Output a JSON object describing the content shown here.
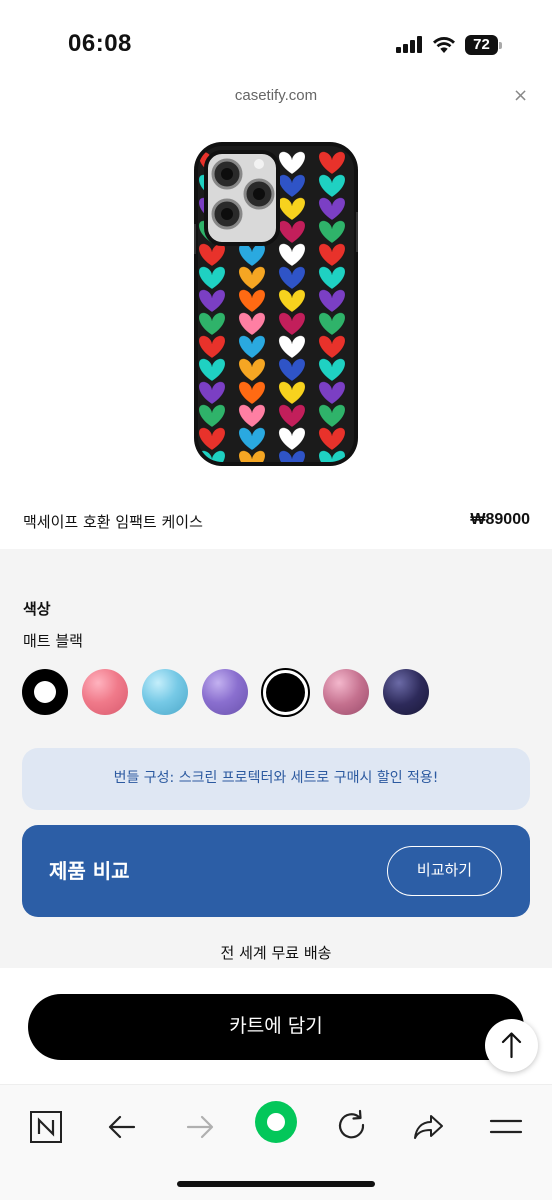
{
  "status_bar": {
    "time": "06:08",
    "battery_level": "72",
    "signal_icon": "signal-icon",
    "wifi_icon": "wifi-icon"
  },
  "url_bar": {
    "domain": "casetify.com",
    "close_symbol": "×"
  },
  "product": {
    "name": "맥세이프 호환 임팩트 케이스",
    "price": "₩89000"
  },
  "color_options": {
    "label": "색상",
    "selected_name": "매트 블랙",
    "swatches": [
      {
        "name": "black-white",
        "color": "#000000"
      },
      {
        "name": "pink",
        "color": "#f07a8a"
      },
      {
        "name": "sky-blue",
        "color": "#76c9e6"
      },
      {
        "name": "lavender",
        "color": "#8a6fcf"
      },
      {
        "name": "matte-black",
        "color": "#000000",
        "selected": true
      },
      {
        "name": "pink-glitter",
        "color": "#c4708e"
      },
      {
        "name": "navy-glitter",
        "color": "#2d2a5a"
      }
    ]
  },
  "bundle_banner": {
    "text": "번들 구성: 스크린 프로텍터와 세트로 구매시 할인 적용!"
  },
  "compare": {
    "title": "제품 비교",
    "button_label": "비교하기"
  },
  "shipping": {
    "text": "전 세계 무료 배송"
  },
  "cart": {
    "button_label": "카트에 담기"
  },
  "browser_nav": {
    "items": [
      "naver-home-icon",
      "back-arrow-icon",
      "forward-arrow-icon",
      "green-dot-icon",
      "refresh-icon",
      "share-icon",
      "menu-icon"
    ]
  },
  "colors": {
    "accent_blue": "#2c5ea6",
    "banner_bg": "#dfe7f3",
    "banner_text": "#2c5aa0",
    "naver_green": "#03c75a"
  }
}
